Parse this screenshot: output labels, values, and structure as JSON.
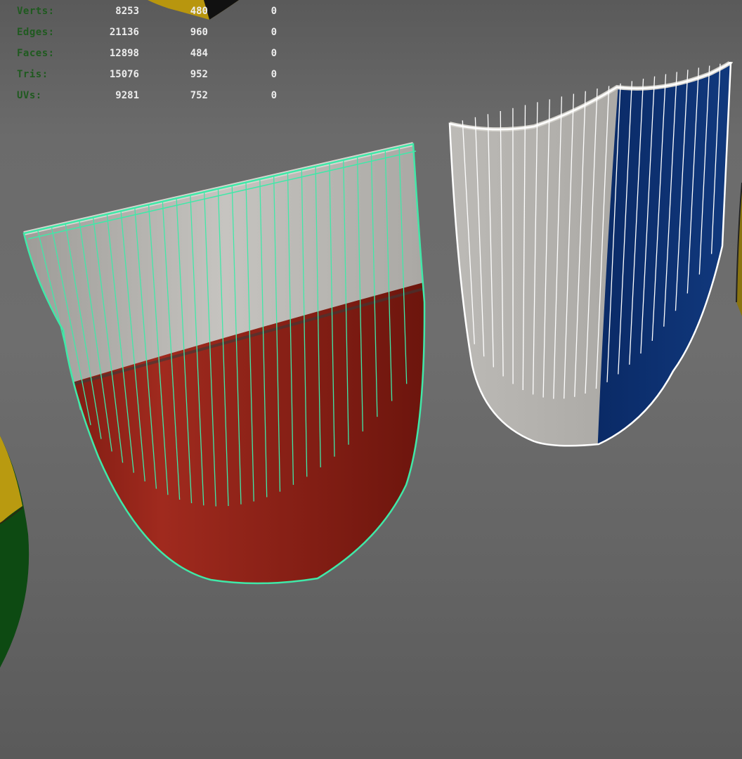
{
  "hud": {
    "rows": [
      {
        "label": "Verts:",
        "total": "8253",
        "selected": "480",
        "highlighted": "0"
      },
      {
        "label": "Edges:",
        "total": "21136",
        "selected": "960",
        "highlighted": "0"
      },
      {
        "label": "Faces:",
        "total": "12898",
        "selected": "484",
        "highlighted": "0"
      },
      {
        "label": "Tris:",
        "total": "15076",
        "selected": "952",
        "highlighted": "0"
      },
      {
        "label": "UVs:",
        "total": "9281",
        "selected": "752",
        "highlighted": "0"
      }
    ]
  },
  "scene": {
    "colors": {
      "viewport_bg": "#666666",
      "hud_label": "#1f5a1f",
      "hud_value": "#ececec",
      "selection_wire": "#40e8a8",
      "unselected_wire": "#ffffff",
      "shield_red": "#8a1e14",
      "shield_silver": "#b8b6b2",
      "shield_blue": "#0d2f6e",
      "shield_yellow": "#b99a10",
      "shield_green": "#0d4a12"
    },
    "objects": [
      {
        "name": "shield-red-silver",
        "state": "selected",
        "wire_color": "#40e8a8"
      },
      {
        "name": "shield-silver-blue",
        "state": "unselected",
        "wire_color": "#ffffff"
      },
      {
        "name": "shield-yellow-green",
        "state": "partially visible"
      },
      {
        "name": "shield-yellow-black",
        "state": "partially visible"
      }
    ]
  }
}
